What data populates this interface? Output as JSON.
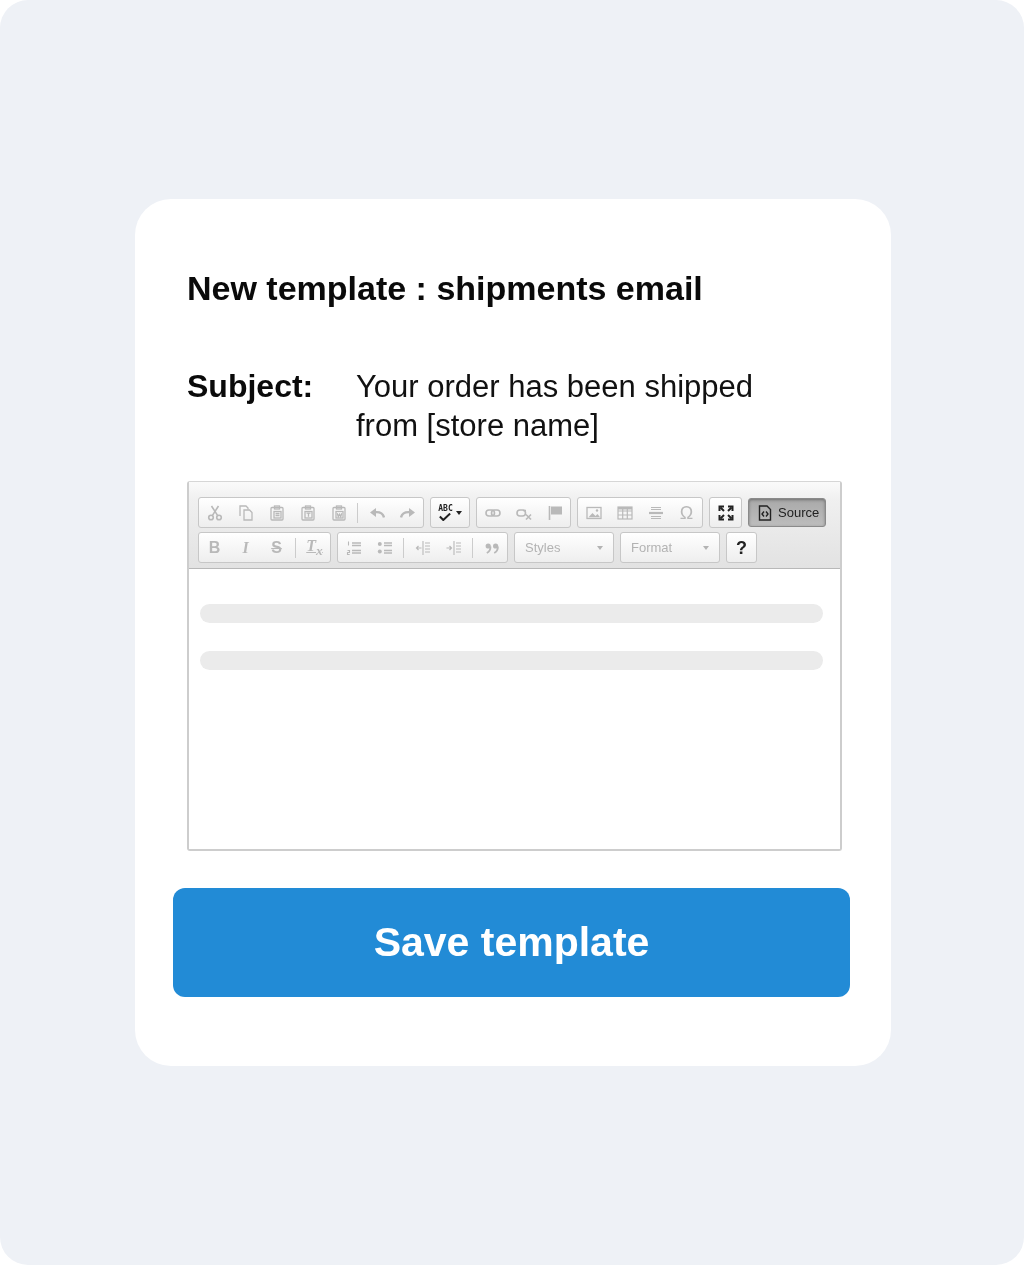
{
  "card": {
    "title": "New template : shipments email"
  },
  "subject": {
    "label": "Subject:",
    "value": "Your order has been shipped from [store name]"
  },
  "editor": {
    "toolbar_rows": [
      {
        "groups": [
          {
            "framed": true,
            "parts": [
              {
                "items": [
                  {
                    "kind": "scissors",
                    "disabled": true,
                    "on": false
                  },
                  {
                    "kind": "copy",
                    "disabled": true,
                    "on": false
                  },
                  {
                    "kind": "paste",
                    "disabled": true,
                    "on": false
                  },
                  {
                    "kind": "paste-text",
                    "disabled": true,
                    "on": false
                  },
                  {
                    "kind": "paste-word",
                    "disabled": true,
                    "on": false
                  }
                ]
              },
              {
                "items": [
                  {
                    "kind": "undo",
                    "disabled": true,
                    "on": false
                  },
                  {
                    "kind": "redo",
                    "disabled": true,
                    "on": false
                  }
                ]
              }
            ]
          },
          {
            "framed": true,
            "parts": [
              {
                "items": [
                  {
                    "kind": "spellcheck",
                    "glyph": "ABC",
                    "disabled": false,
                    "on": false
                  }
                ]
              }
            ]
          },
          {
            "framed": true,
            "parts": [
              {
                "items": [
                  {
                    "kind": "link",
                    "disabled": true,
                    "on": false
                  },
                  {
                    "kind": "unlink",
                    "disabled": true,
                    "on": false
                  },
                  {
                    "kind": "anchor",
                    "disabled": true,
                    "on": false
                  }
                ]
              }
            ]
          },
          {
            "framed": true,
            "parts": [
              {
                "items": [
                  {
                    "kind": "image",
                    "disabled": true,
                    "on": false
                  },
                  {
                    "kind": "table",
                    "disabled": true,
                    "on": false
                  },
                  {
                    "kind": "horizontal-line",
                    "disabled": true,
                    "on": false
                  },
                  {
                    "kind": "special-char",
                    "glyph": "Ω",
                    "disabled": true,
                    "on": false
                  }
                ]
              }
            ]
          },
          {
            "framed": true,
            "parts": [
              {
                "items": [
                  {
                    "kind": "maximize",
                    "disabled": false,
                    "on": false
                  }
                ]
              }
            ]
          },
          {
            "framed": false,
            "parts": [
              {
                "items": [
                  {
                    "kind": "source",
                    "label": "Source",
                    "disabled": false,
                    "on": true
                  }
                ]
              }
            ]
          }
        ]
      },
      {
        "groups": [
          {
            "framed": true,
            "parts": [
              {
                "items": [
                  {
                    "kind": "bold",
                    "glyph": "B",
                    "disabled": true,
                    "on": false
                  },
                  {
                    "kind": "italic",
                    "glyph": "I",
                    "disabled": true,
                    "on": false
                  },
                  {
                    "kind": "strike",
                    "glyph": "S",
                    "disabled": true,
                    "on": false
                  }
                ]
              },
              {
                "items": [
                  {
                    "kind": "remove-format",
                    "glyph": "T$_{x}$",
                    "disabled": true,
                    "on": false
                  }
                ]
              }
            ]
          },
          {
            "framed": true,
            "parts": [
              {
                "items": [
                  {
                    "kind": "numbered-list",
                    "disabled": true,
                    "on": false
                  },
                  {
                    "kind": "bulleted-list",
                    "disabled": true,
                    "on": false
                  }
                ]
              },
              {
                "items": [
                  {
                    "kind": "outdent",
                    "disabled": true,
                    "on": false
                  },
                  {
                    "kind": "indent",
                    "disabled": true,
                    "on": false
                  }
                ]
              },
              {
                "items": [
                  {
                    "kind": "blockquote",
                    "disabled": true,
                    "on": false
                  }
                ]
              }
            ]
          },
          {
            "framed": false,
            "parts": [
              {
                "items": [
                  {
                    "kind": "dropdown",
                    "label": "Styles",
                    "disabled": true,
                    "on": false
                  }
                ]
              }
            ]
          },
          {
            "framed": false,
            "parts": [
              {
                "items": [
                  {
                    "kind": "dropdown",
                    "label": "Format",
                    "disabled": true,
                    "on": false
                  }
                ]
              }
            ]
          },
          {
            "framed": true,
            "parts": [
              {
                "items": [
                  {
                    "kind": "help",
                    "glyph": "?",
                    "disabled": false,
                    "on": false
                  }
                ]
              }
            ]
          }
        ]
      }
    ],
    "content": [
      {
        "kind": "skeleton"
      },
      {
        "kind": "skeleton"
      }
    ]
  },
  "save_button": {
    "label": "Save template"
  }
}
